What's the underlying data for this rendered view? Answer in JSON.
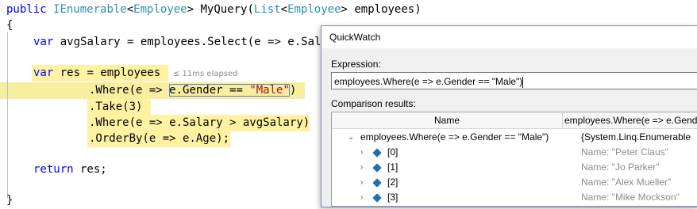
{
  "code": {
    "line1": {
      "kw": "public",
      "t1": "IEnumerable",
      "p1": "<",
      "t2": "Employee",
      "p2": "> MyQuery(",
      "t3": "List",
      "p3": "<",
      "t4": "Employee",
      "p4": "> employees)"
    },
    "line2": "{",
    "line3": {
      "kw": "var",
      "rest": " avgSalary = employees.Select(e => e.Sal"
    },
    "line4": {
      "kw": "var",
      "rest": " res = employees"
    },
    "line5": {
      "pre": ".Where(e => ",
      "boxed_a": "e.Gender == ",
      "str": "\"Male\"",
      "post": ")"
    },
    "line6": ".Take(3)",
    "line7": ".Where(e => e.Salary > avgSalary)",
    "line8": ".OrderBy(e => e.Age);",
    "line9": {
      "kw": "return",
      "rest": " res;"
    },
    "line10": "}",
    "elapsed": "≤ 11ms elapsed"
  },
  "quickwatch": {
    "title": "QuickWatch",
    "expression_label": "Expression:",
    "expression_value": "employees.Where(e => e.Gender == \"Male\")",
    "results_label": "Comparison results:",
    "columns": {
      "name": "Name",
      "value": "employees.Where(e => e.Gender"
    },
    "root": {
      "name": "employees.Where(e => e.Gender == \"Male\")",
      "value": "{System.Linq.Enumerable"
    },
    "items": [
      {
        "name": "[0]",
        "value": "Name: \"Peter Claus\""
      },
      {
        "name": "[1]",
        "value": "Name: \"Jo Parker\""
      },
      {
        "name": "[2]",
        "value": "Name: \"Alex Mueller\""
      },
      {
        "name": "[3]",
        "value": "Name: \"Mike Mockson\""
      }
    ]
  },
  "icons": [
    "chevron-down-icon",
    "chevron-right-icon",
    "object-cube-icon",
    "pencil-icon"
  ],
  "colors": {
    "keyword": "#0000ff",
    "type": "#2b91af",
    "string": "#a31515",
    "highlight": "#fff3a3"
  }
}
